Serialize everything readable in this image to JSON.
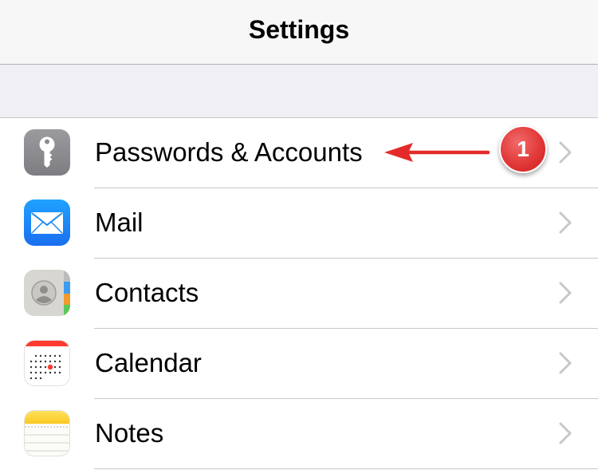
{
  "nav": {
    "title": "Settings"
  },
  "rows": [
    {
      "label": "Passwords & Accounts",
      "icon": "key-icon"
    },
    {
      "label": "Mail",
      "icon": "envelope-icon"
    },
    {
      "label": "Contacts",
      "icon": "contact-icon"
    },
    {
      "label": "Calendar",
      "icon": "calendar-icon"
    },
    {
      "label": "Notes",
      "icon": "notes-icon"
    }
  ],
  "annotation": {
    "badge": "1"
  },
  "colors": {
    "annotation_red": "#e23838",
    "mail_blue": "#1e8cf0",
    "key_gray": "#8e8e93",
    "calendar_red": "#ff3b30",
    "notes_yellow": "#ffcc00"
  }
}
